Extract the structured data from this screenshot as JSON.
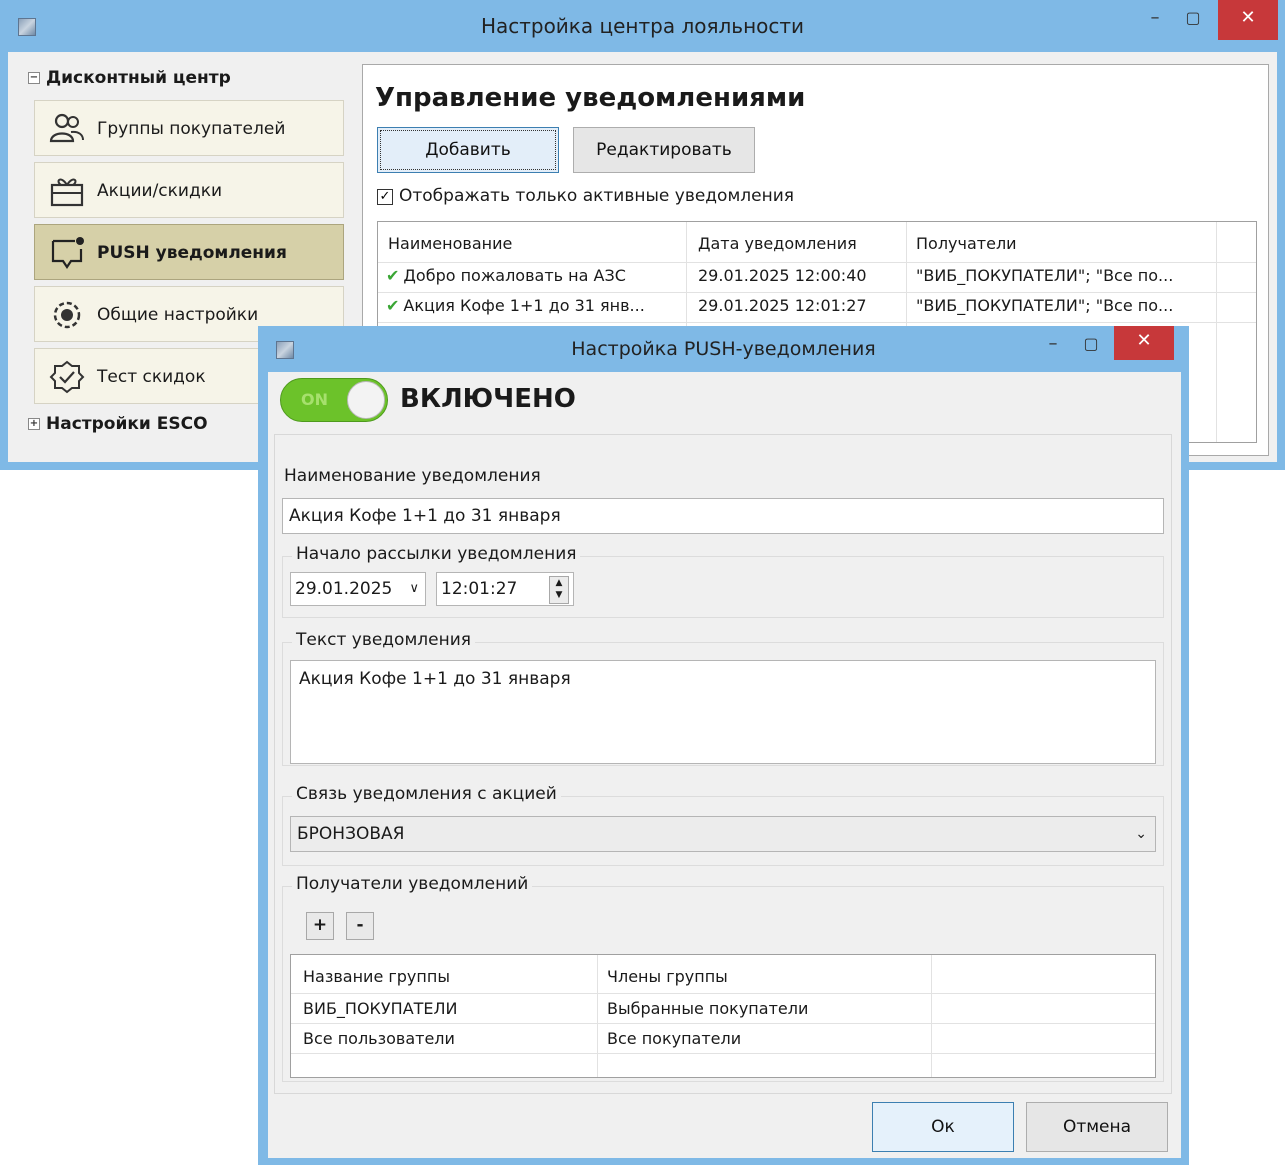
{
  "main_window": {
    "title": "Настройка центра лояльности",
    "sidebar": {
      "section1": "Дисконтный центр",
      "items": [
        {
          "label": "Группы покупателей",
          "icon": "users-icon"
        },
        {
          "label": "Акции/скидки",
          "icon": "gift-icon"
        },
        {
          "label": "PUSH уведомления",
          "icon": "notification-icon"
        },
        {
          "label": "Общие настройки",
          "icon": "gear-icon"
        },
        {
          "label": "Тест скидок",
          "icon": "check-badge-icon"
        }
      ],
      "section2": "Настройки ESCO"
    },
    "panel": {
      "title": "Управление уведомлениями",
      "add_label": "Добавить",
      "edit_label": "Редактировать",
      "only_active_label": "Отображать только активные уведомления",
      "table": {
        "columns": [
          "Наименование",
          "Дата уведомления",
          "Получатели"
        ],
        "rows": [
          [
            "Добро пожаловать на АЗС",
            "29.01.2025 12:00:40",
            "\"ВИБ_ПОКУПАТЕЛИ\"; \"Все по..."
          ],
          [
            "Акция Кофе 1+1 до 31 янв...",
            "29.01.2025 12:01:27",
            "\"ВИБ_ПОКУПАТЕЛИ\"; \"Все по..."
          ]
        ]
      }
    }
  },
  "dialog": {
    "title": "Настройка PUSH-уведомления",
    "toggle_text": "ON",
    "status": "ВКЛЮЧЕНО",
    "name_label": "Наименование уведомления",
    "name_value": "Акция Кофе 1+1 до 31 января",
    "start_group": "Начало рассылки уведомления",
    "date": "29.01.2025",
    "time": "12:01:27",
    "text_group": "Текст уведомления",
    "text_value": "Акция Кофе 1+1 до 31 января",
    "promo_group": "Связь уведомления с акцией",
    "promo_value": "БРОНЗОВАЯ",
    "recipients_group": "Получатели уведомлений",
    "add_symbol": "+",
    "remove_symbol": "-",
    "recipients_table": {
      "columns": [
        "Название группы",
        "Члены группы"
      ],
      "rows": [
        [
          "ВИБ_ПОКУПАТЕЛИ",
          "Выбранные покупатели"
        ],
        [
          "Все пользователи",
          "Все покупатели"
        ]
      ]
    },
    "ok_label": "Ок",
    "cancel_label": "Отмена"
  },
  "colors": {
    "titlebar": "#7fb9e6",
    "close": "#c7383a",
    "toggle_on": "#6cc22a",
    "check_green": "#3aa635"
  }
}
